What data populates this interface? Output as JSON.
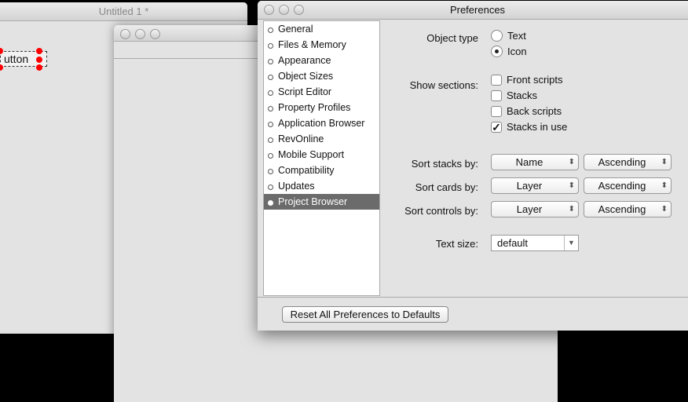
{
  "untitled": {
    "title": "Untitled 1 *",
    "button_label": "utton"
  },
  "prefs": {
    "title": "Preferences",
    "sidebar": [
      "General",
      "Files & Memory",
      "Appearance",
      "Object Sizes",
      "Script Editor",
      "Property Profiles",
      "Application Browser",
      "RevOnline",
      "Mobile Support",
      "Compatibility",
      "Updates",
      "Project Browser"
    ],
    "selected": "Project Browser",
    "object_type": {
      "label": "Object type",
      "options": [
        "Text",
        "Icon"
      ],
      "selected": "Icon"
    },
    "show_sections": {
      "label": "Show sections:",
      "items": [
        {
          "label": "Front scripts",
          "checked": false
        },
        {
          "label": "Stacks",
          "checked": false
        },
        {
          "label": "Back scripts",
          "checked": false
        },
        {
          "label": "Stacks in use",
          "checked": true
        }
      ]
    },
    "sorts": [
      {
        "label": "Sort stacks by:",
        "field": "Name",
        "order": "Ascending"
      },
      {
        "label": "Sort cards by:",
        "field": "Layer",
        "order": "Ascending"
      },
      {
        "label": "Sort controls by:",
        "field": "Layer",
        "order": "Ascending"
      }
    ],
    "text_size": {
      "label": "Text size:",
      "value": "default"
    },
    "reset_label": "Reset All Preferences to Defaults"
  }
}
